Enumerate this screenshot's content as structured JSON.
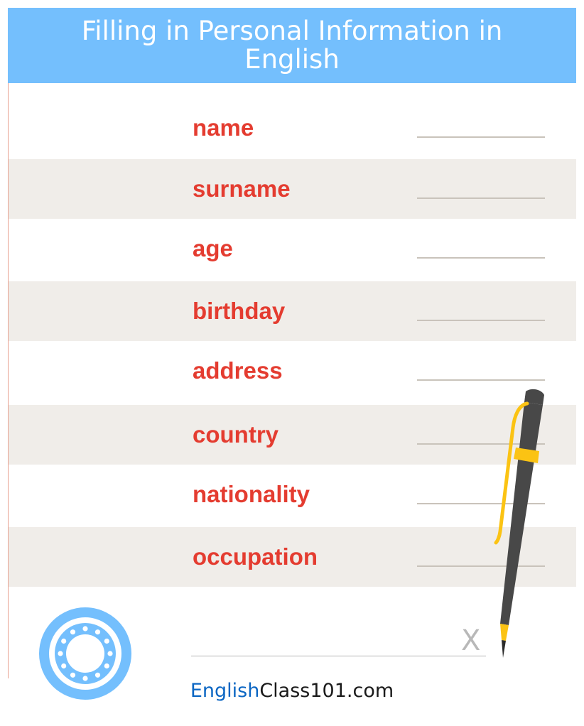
{
  "header": {
    "title": "Filling in Personal Information in English",
    "background_color": "#74bffd"
  },
  "form": {
    "fields": [
      {
        "label": "name"
      },
      {
        "label": "surname"
      },
      {
        "label": "age"
      },
      {
        "label": "birthday"
      },
      {
        "label": "address"
      },
      {
        "label": "country"
      },
      {
        "label": "nationality"
      },
      {
        "label": "occupation"
      }
    ],
    "label_color": "#e43c30",
    "shaded_row_color": "#f0ede9"
  },
  "signature": {
    "mark": "X"
  },
  "footer": {
    "brand_accent": "English",
    "brand_rest": "Class101.com",
    "accent_color": "#0b66c3"
  },
  "decorations": {
    "seal_icon": "stamp-seal-icon",
    "pen_icon": "pen-icon",
    "seal_color": "#74bffd",
    "pen_body_color": "#484848",
    "pen_accent_color": "#fbc313"
  }
}
